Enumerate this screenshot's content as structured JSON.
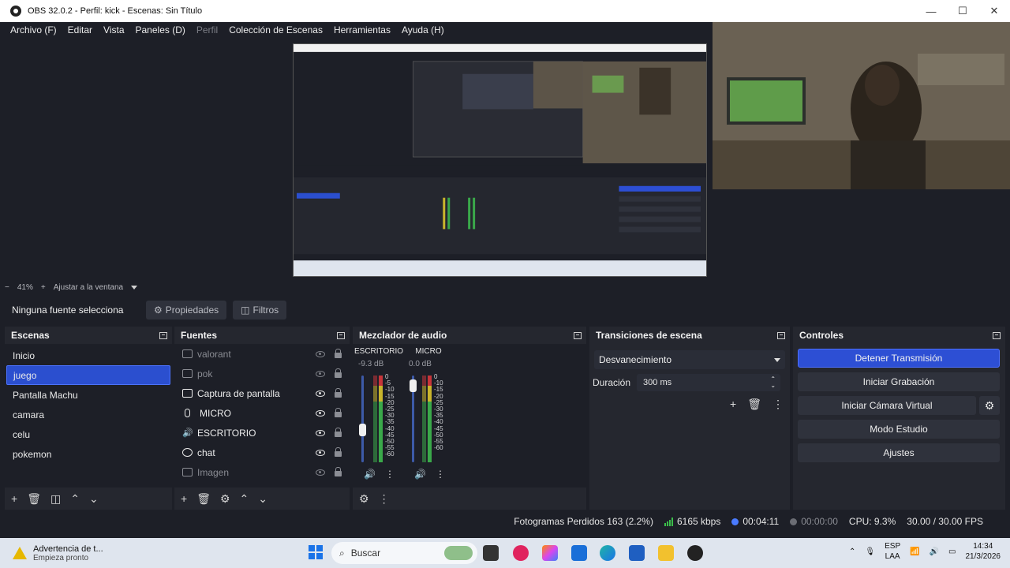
{
  "window": {
    "title": "OBS 32.0.2 - Perfil: kick - Escenas: Sin Título",
    "minimize": "—",
    "maximize": "☐",
    "close": "✕"
  },
  "menu": [
    "Archivo (F)",
    "Editar",
    "Vista",
    "Paneles (D)",
    "Perfil",
    "Colección de Escenas",
    "Herramientas",
    "Ayuda (H)"
  ],
  "zoom": {
    "minus": "−",
    "level": "41%",
    "plus": "+",
    "fit": "Ajustar a la ventana"
  },
  "context": {
    "no_source": "Ninguna fuente selecciona",
    "properties": "Propiedades",
    "filters": "Filtros"
  },
  "scenes": {
    "title": "Escenas",
    "items": [
      "Inicio",
      "juego",
      "Pantalla Machu",
      "camara",
      "celu",
      "pokemon"
    ],
    "selected_index": 1
  },
  "sources": {
    "title": "Fuentes",
    "items": [
      {
        "label": "valorant",
        "visible": false,
        "icon": "window-capture-icon"
      },
      {
        "label": "pok",
        "visible": false,
        "icon": "window-capture-icon"
      },
      {
        "label": "Captura de pantalla",
        "visible": true,
        "icon": "display-capture-icon"
      },
      {
        "label": "MICRO",
        "visible": true,
        "icon": "microphone-icon"
      },
      {
        "label": "ESCRITORIO",
        "visible": true,
        "icon": "speaker-icon"
      },
      {
        "label": "chat",
        "visible": true,
        "icon": "browser-icon"
      },
      {
        "label": "Imagen",
        "visible": false,
        "icon": "image-icon"
      }
    ]
  },
  "mixer": {
    "title": "Mezclador de audio",
    "channels": [
      {
        "name": "ESCRITORIO",
        "db": "-9.3 dB",
        "fader_level": 0.35
      },
      {
        "name": "MICRO",
        "db": "0.0 dB",
        "fader_level": 0.95
      }
    ],
    "scale": [
      "0",
      "-5",
      "-10",
      "-15",
      "-20",
      "-25",
      "-30",
      "-35",
      "-40",
      "-45",
      "-50",
      "-55",
      "-60"
    ]
  },
  "transitions": {
    "title": "Transiciones de escena",
    "selected": "Desvanecimiento",
    "duration_label": "Duración",
    "duration_value": "300 ms"
  },
  "controls": {
    "title": "Controles",
    "stop_stream": "Detener Transmisión",
    "start_recording": "Iniciar Grabación",
    "start_virtual_cam": "Iniciar Cámara Virtual",
    "studio_mode": "Modo Estudio",
    "settings": "Ajustes"
  },
  "status": {
    "dropped_frames": "Fotogramas Perdidos 163 (2.2%)",
    "bitrate": "6165 kbps",
    "stream_time": "00:04:11",
    "record_time": "00:00:00",
    "cpu": "CPU: 9.3%",
    "fps": "30.00 / 30.00 FPS",
    "accent_live": "#d93a3a"
  },
  "taskbar": {
    "weather_title": "Advertencia de t...",
    "weather_sub": "Empieza pronto",
    "search": "Buscar",
    "lang1": "ESP",
    "lang2": "LAA",
    "time": "14:34",
    "date": "21/3/2026"
  },
  "colors": {
    "accent": "#2d4fd4",
    "background": "#1d1f27",
    "panel": "#25272f"
  }
}
